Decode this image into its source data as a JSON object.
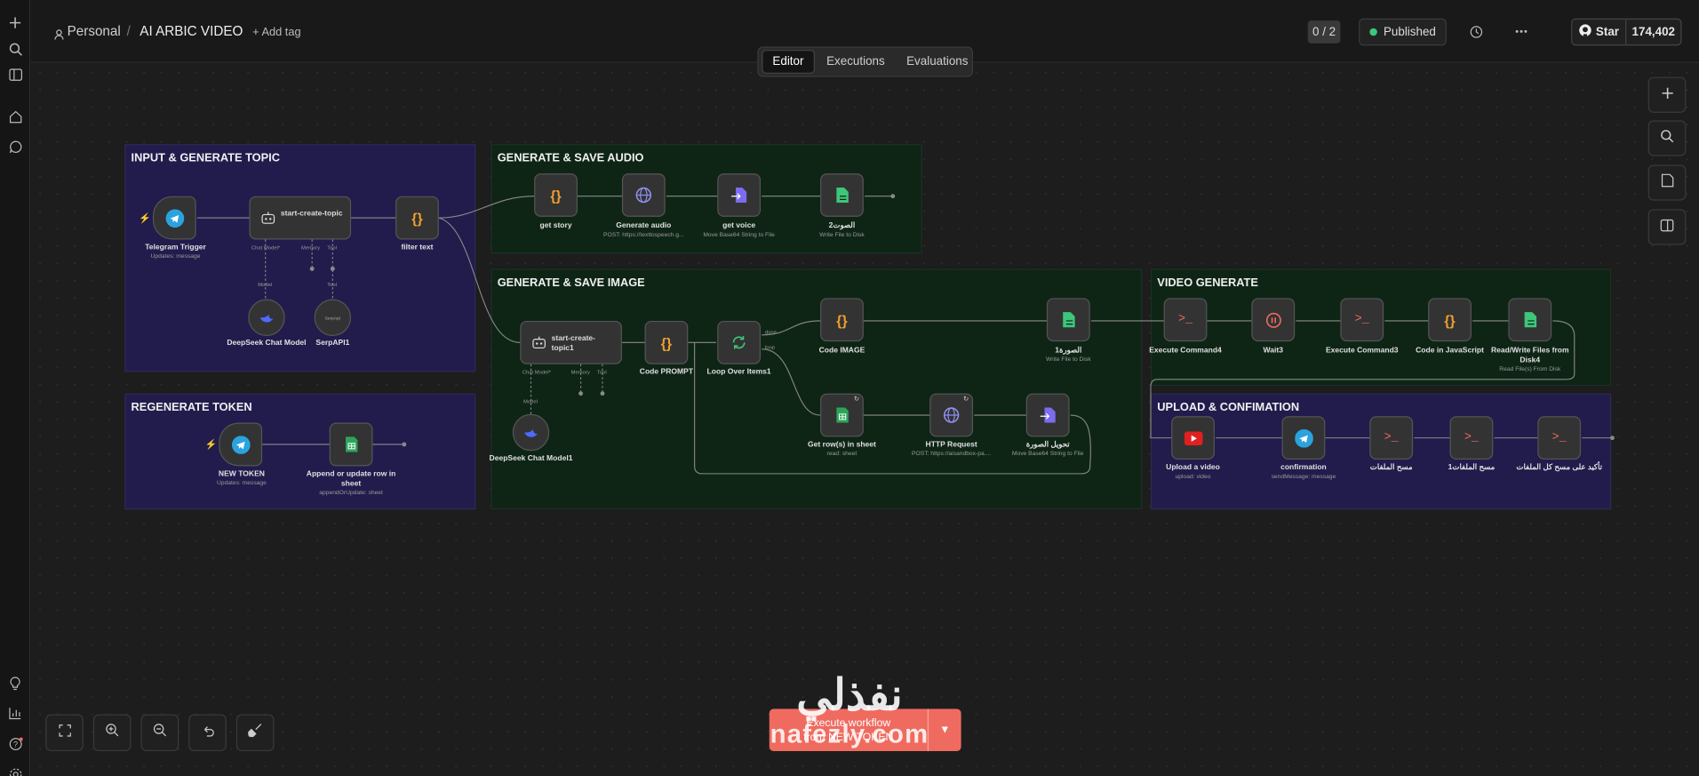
{
  "sidebar": {
    "icons": [
      "plus-icon",
      "search-icon",
      "panel-icon",
      "home-icon",
      "chat-icon",
      "lightbulb-icon",
      "chart-icon",
      "help-icon",
      "settings-icon"
    ]
  },
  "header": {
    "project": "Personal",
    "separator": "/",
    "workflow_name": "AI ARBIC VIDEO",
    "add_tag": "+ Add tag",
    "counter": "0 / 2",
    "status": "Published",
    "github_star": "Star",
    "star_count": "174,402"
  },
  "tabs": [
    "Editor",
    "Executions",
    "Evaluations"
  ],
  "groups": {
    "input": "INPUT & GENERATE TOPIC",
    "audio": "GENERATE & SAVE AUDIO",
    "image": "GENERATE & SAVE IMAGE",
    "video": "VIDEO GENERATE",
    "token": "REGENERATE TOKEN",
    "upload": "UPLOAD & CONFIMATION"
  },
  "nodes": {
    "telegram_trigger": {
      "label": "Telegram Trigger",
      "sub": "Updates: message"
    },
    "start_topic": {
      "label": "start-create-topic",
      "c1": "Chat Model*",
      "c2": "Memory",
      "c3": "Tool"
    },
    "filter_text": {
      "label": "filter text"
    },
    "deepseek": {
      "label": "DeepSeek Chat Model",
      "conn": "Model"
    },
    "serpapi": {
      "label": "SerpAPI1",
      "conn": "Tool",
      "inner": "SerpApi"
    },
    "get_story": {
      "label": "get story"
    },
    "gen_audio": {
      "label": "Generate audio",
      "sub": "POST: https://texttospeech.g..."
    },
    "get_voice": {
      "label": "get voice",
      "sub": "Move Base64 String to File"
    },
    "save_audio": {
      "label": "الصوت2",
      "sub": "Write File to Disk"
    },
    "start_topic1": {
      "label": "start-create-topic1",
      "c1": "Chat Model*",
      "c2": "Memory",
      "c3": "Tool"
    },
    "code_prompt": {
      "label": "Code PROMPT"
    },
    "loop": {
      "label": "Loop Over Items1",
      "done": "done",
      "loop": "loop"
    },
    "code_image": {
      "label": "Code IMAGE"
    },
    "save_image": {
      "label": "الصورة1",
      "sub": "Write File to Disk"
    },
    "get_rows": {
      "label": "Get row(s) in sheet",
      "sub": "read: sheet"
    },
    "http": {
      "label": "HTTP Request",
      "sub": "POST: https://aisandbox-pa...."
    },
    "convert_image": {
      "label": "تحويل الصورة",
      "sub": "Move Base64 String to File"
    },
    "deepseek1": {
      "label": "DeepSeek Chat Model1",
      "conn": "Model"
    },
    "exec4": {
      "label": "Execute Command4"
    },
    "wait3": {
      "label": "Wait3"
    },
    "exec3": {
      "label": "Execute Command3"
    },
    "code_js": {
      "label": "Code in JavaScript"
    },
    "rw_files": {
      "label": "Read/Write Files from Disk4",
      "sub": "Read File(s) From Disk"
    },
    "new_token": {
      "label": "NEW TOKEN",
      "sub": "Updates: message"
    },
    "append_row": {
      "label": "Append or update row in sheet",
      "sub": "appendOrUpdate: sheet"
    },
    "upload_video": {
      "label": "Upload a video",
      "sub": "upload: video"
    },
    "confirmation": {
      "label": "confirmation",
      "sub": "sendMessage: message"
    },
    "erase1": {
      "label": "مسح الملفات"
    },
    "erase2": {
      "label": "مسح الملفات1"
    },
    "erase3": {
      "label": "تأكيد على مسح كل الملفات"
    }
  },
  "execute": {
    "line1": "Execute workflow",
    "line2": "from NEW TOKEN"
  },
  "watermark": {
    "arabic": "نفذلي",
    "latin": "nafezly.com"
  },
  "colors": {
    "purple_group": "#211c4c",
    "green_group": "#0e2516",
    "execute": "#ef6b5f",
    "published": "#3ec67b"
  }
}
